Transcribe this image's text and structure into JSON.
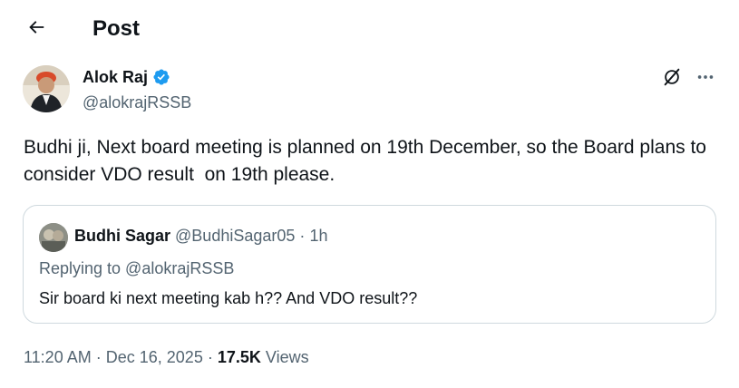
{
  "header": {
    "title": "Post",
    "back_icon": "arrow-left-icon"
  },
  "author": {
    "name": "Alok Raj",
    "handle": "@alokrajRSSB",
    "verified": true,
    "verified_color": "#1d9bf0"
  },
  "actions": {
    "grok_icon": "grok-icon",
    "more_icon": "more-horizontal-icon"
  },
  "tweet": {
    "text": "Budhi ji, Next board meeting is planned on 19th December, so the Board plans to consider VDO result  on 19th please."
  },
  "quote": {
    "name": "Budhi Sagar",
    "handle": "@BudhiSagar05",
    "separator": "·",
    "time": "1h",
    "replying_to": "Replying to @alokrajRSSB",
    "text": "Sir board ki next meeting kab h?? And VDO result??"
  },
  "meta": {
    "time": "11:20 AM",
    "separator": "·",
    "date": "Dec 16, 2025",
    "views_count": "17.5K",
    "views_label": "Views"
  },
  "colors": {
    "text": "#0f1419",
    "secondary": "#536471",
    "border": "#cfd9de",
    "accent": "#1d9bf0"
  }
}
